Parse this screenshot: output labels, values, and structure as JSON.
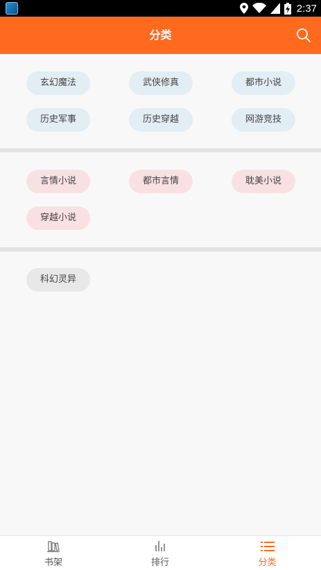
{
  "status_bar": {
    "time": "2:37"
  },
  "header": {
    "title": "分类"
  },
  "sections": [
    {
      "tags": [
        "玄幻魔法",
        "武侠修真",
        "都市小说",
        "历史军事",
        "历史穿越",
        "网游竞技"
      ]
    },
    {
      "tags": [
        "言情小说",
        "都市言情",
        "耽美小说",
        "穿越小说"
      ]
    },
    {
      "tags": [
        "科幻灵异"
      ]
    }
  ],
  "bottom_nav": {
    "items": [
      {
        "label": "书架",
        "icon": "bookshelf-icon",
        "active": false
      },
      {
        "label": "排行",
        "icon": "ranking-icon",
        "active": false
      },
      {
        "label": "分类",
        "icon": "list-icon",
        "active": true
      }
    ]
  },
  "colors": {
    "accent": "#ff6a1f",
    "tag_blue": "#e2edf4",
    "tag_pink": "#f9e1e3",
    "tag_gray": "#e8e8e8"
  }
}
